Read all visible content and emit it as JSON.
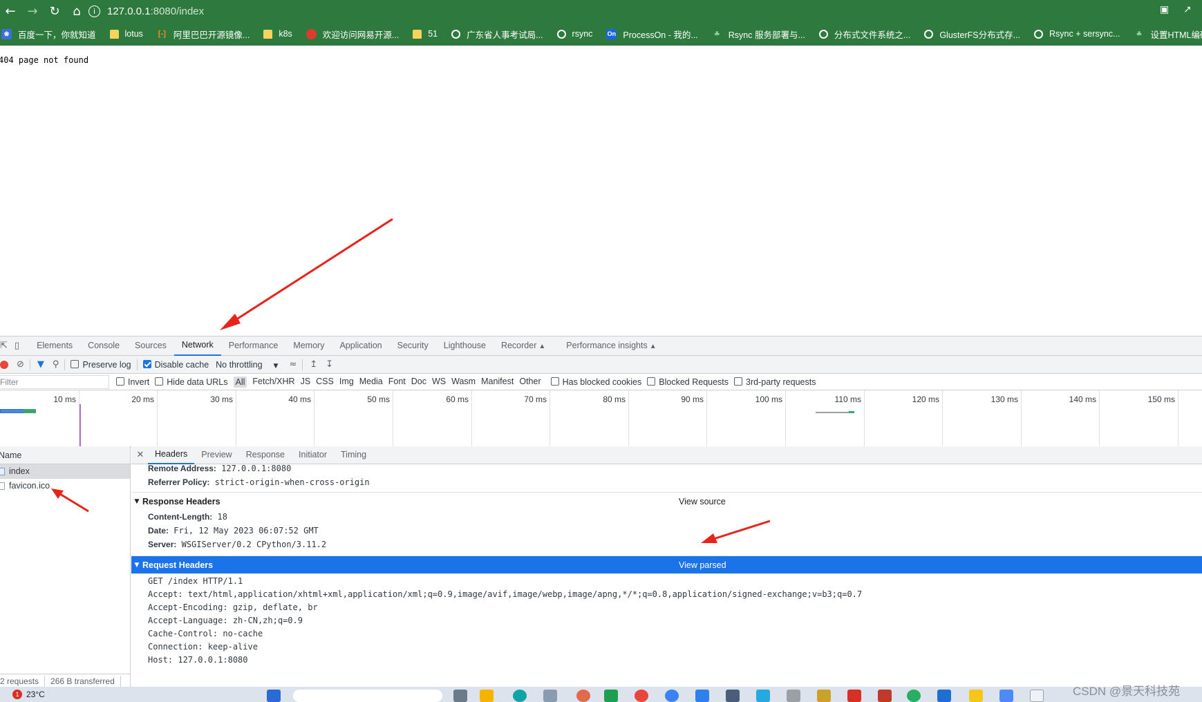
{
  "browser": {
    "url_host": "127.0.0.1",
    "url_path": ":8080/index",
    "bookmarks": [
      {
        "label": "百度一下，你就知道",
        "icon": "baidu-icon"
      },
      {
        "label": "lotus",
        "icon": "folder-icon"
      },
      {
        "label": "阿里巴巴开源镜像...",
        "icon": "aliyun-icon"
      },
      {
        "label": "k8s",
        "icon": "folder-icon"
      },
      {
        "label": "欢迎访问网易开源...",
        "icon": "netease-icon"
      },
      {
        "label": "51",
        "icon": "folder-icon"
      },
      {
        "label": "广东省人事考试局...",
        "icon": "globe-icon"
      },
      {
        "label": "rsync",
        "icon": "globe-icon"
      },
      {
        "label": "ProcessOn - 我的...",
        "icon": "processon-icon"
      },
      {
        "label": "Rsync 服务部署与...",
        "icon": "leaf-icon"
      },
      {
        "label": "分布式文件系统之...",
        "icon": "globe-icon"
      },
      {
        "label": "GlusterFS分布式存...",
        "icon": "globe-icon"
      },
      {
        "label": "Rsync + sersync...",
        "icon": "globe-icon"
      },
      {
        "label": "设置HTML编码为U...",
        "icon": "leaf-icon"
      }
    ]
  },
  "page": {
    "body_text": "404 page not found"
  },
  "devtools": {
    "tabs": [
      "Elements",
      "Console",
      "Sources",
      "Network",
      "Performance",
      "Memory",
      "Application",
      "Security",
      "Lighthouse",
      "Recorder",
      "Performance insights"
    ],
    "active_tab": "Network",
    "toolbar": {
      "preserve_log": "Preserve log",
      "disable_cache": "Disable cache",
      "throttling": "No throttling"
    },
    "filter": {
      "placeholder": "Filter",
      "invert": "Invert",
      "hide_data_urls": "Hide data URLs",
      "types": [
        "All",
        "Fetch/XHR",
        "JS",
        "CSS",
        "Img",
        "Media",
        "Font",
        "Doc",
        "WS",
        "Wasm",
        "Manifest",
        "Other"
      ],
      "has_blocked_cookies": "Has blocked cookies",
      "blocked_requests": "Blocked Requests",
      "third_party": "3rd-party requests"
    },
    "timeline_ticks": [
      "10 ms",
      "20 ms",
      "30 ms",
      "40 ms",
      "50 ms",
      "60 ms",
      "70 ms",
      "80 ms",
      "90 ms",
      "100 ms",
      "110 ms",
      "120 ms",
      "130 ms",
      "140 ms",
      "150 ms"
    ],
    "requests": {
      "header": "Name",
      "items": [
        "index",
        "favicon.ico"
      ],
      "summary_count": "2 requests",
      "summary_transferred": "266 B transferred"
    },
    "detail": {
      "tabs": [
        "Headers",
        "Preview",
        "Response",
        "Initiator",
        "Timing"
      ],
      "general": [
        {
          "key": "Remote Address:",
          "value": "127.0.0.1:8080"
        },
        {
          "key": "Referrer Policy:",
          "value": "strict-origin-when-cross-origin"
        }
      ],
      "response_headers_title": "Response Headers",
      "response_view_link": "View source",
      "response_headers": [
        {
          "key": "Content-Length:",
          "value": "18"
        },
        {
          "key": "Date:",
          "value": "Fri, 12 May 2023 06:07:52 GMT"
        },
        {
          "key": "Server:",
          "value": "WSGIServer/0.2 CPython/3.11.2"
        }
      ],
      "request_headers_title": "Request Headers",
      "request_view_link": "View parsed",
      "request_raw": [
        "GET /index HTTP/1.1",
        "Accept: text/html,application/xhtml+xml,application/xml;q=0.9,image/avif,image/webp,image/apng,*/*;q=0.8,application/signed-exchange;v=b3;q=0.7",
        "Accept-Encoding: gzip, deflate, br",
        "Accept-Language: zh-CN,zh;q=0.9",
        "Cache-Control: no-cache",
        "Connection: keep-alive",
        "Host: 127.0.0.1:8080"
      ]
    }
  },
  "taskbar": {
    "weather_badge": "1",
    "temperature": "23°C"
  },
  "watermark": "CSDN @景天科技苑",
  "colors": {
    "chrome_green": "#2e7a3e",
    "accent_blue": "#1a73e8",
    "annotation_red": "#e8231a"
  }
}
